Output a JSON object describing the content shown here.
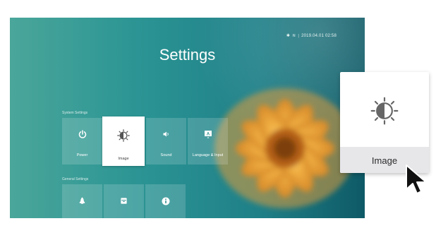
{
  "status": {
    "icons": [
      "bluetooth-icon",
      "wifi-icon"
    ],
    "separator": "|",
    "datetime": "2019.04.01 02:58"
  },
  "title": "Settings",
  "sections": {
    "system": "System Settings",
    "general": "General Settings"
  },
  "system_tiles": [
    {
      "label": "Power",
      "icon": "power-icon"
    },
    {
      "label": "Image",
      "icon": "brightness-icon",
      "selected": true
    },
    {
      "label": "Sound",
      "icon": "speaker-icon"
    },
    {
      "label": "Language & Input",
      "icon": "keyboard-a-icon"
    }
  ],
  "general_tiles": [
    {
      "label": "",
      "icon": "rocket-icon"
    },
    {
      "label": "",
      "icon": "storage-icon"
    },
    {
      "label": "",
      "icon": "info-icon"
    }
  ],
  "callout": {
    "label": "Image",
    "icon": "brightness-icon"
  },
  "colors": {
    "background_teal": "#1f8088",
    "flower_orange": "#f0a030",
    "tile_selected": "#ffffff"
  }
}
